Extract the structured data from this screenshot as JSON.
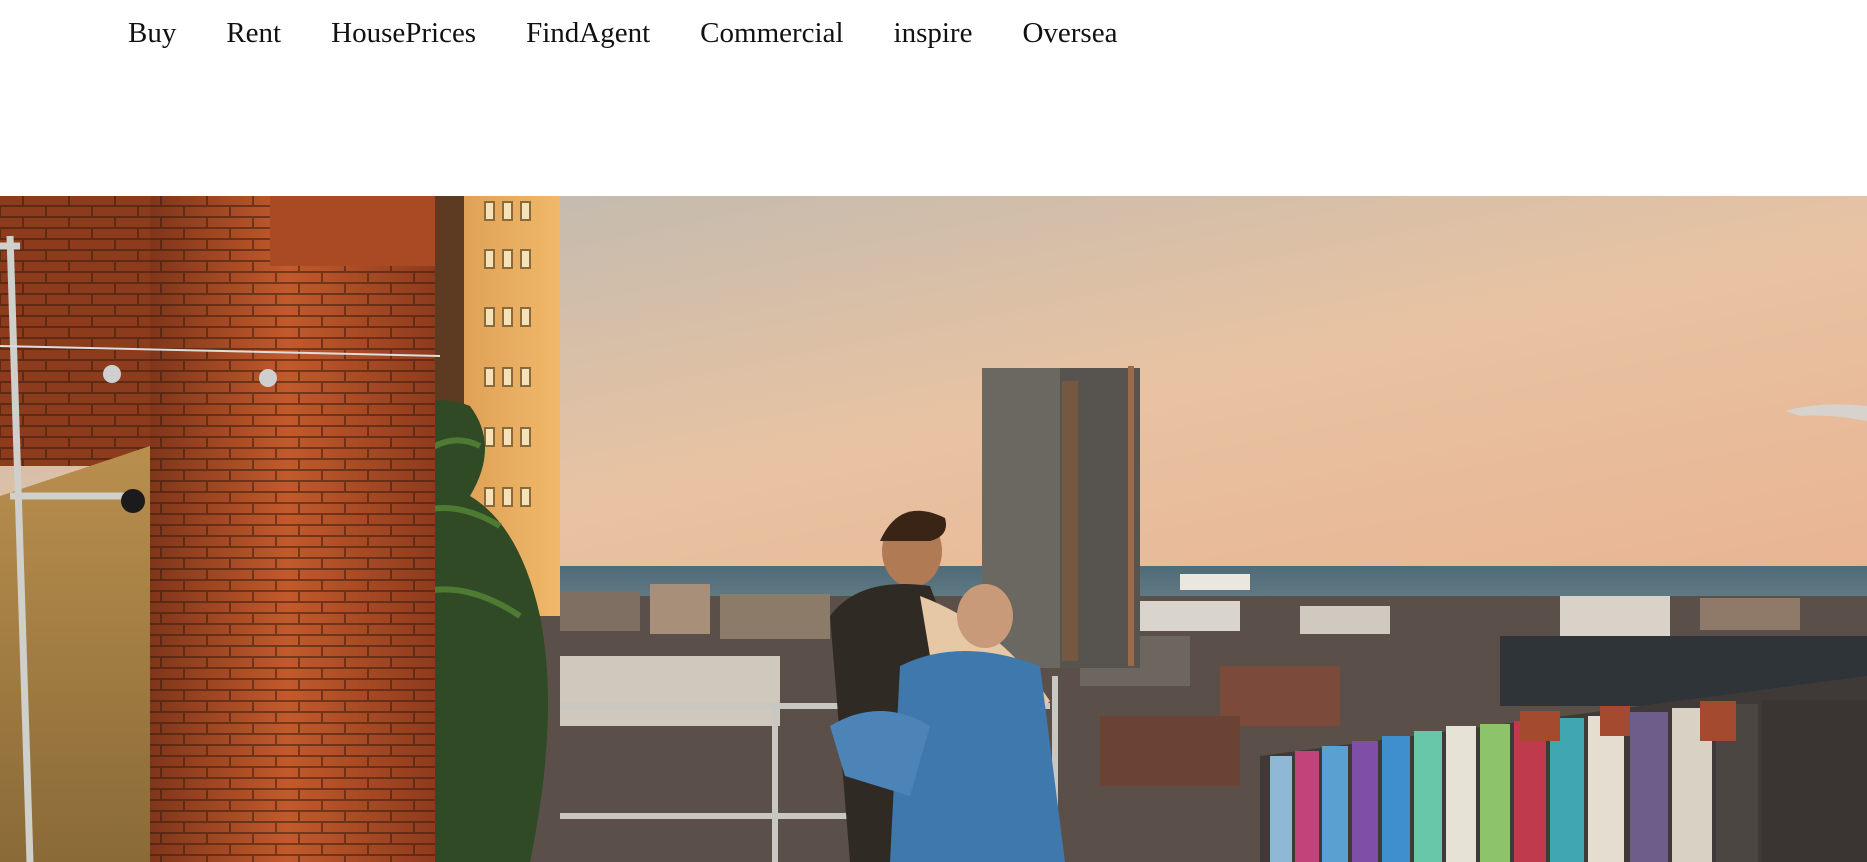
{
  "nav": {
    "items": [
      {
        "label": "Buy"
      },
      {
        "label": "Rent"
      },
      {
        "label": "HousePrices"
      },
      {
        "label": "FindAgent"
      },
      {
        "label": "Commercial"
      },
      {
        "label": "inspire"
      },
      {
        "label": "Oversea"
      }
    ]
  },
  "hero": {
    "colors": {
      "sky_top": "#b9b7b0",
      "sky_bottom": "#f0c6a2",
      "sea": "#5f7a84",
      "brick": "#b6502a",
      "tower": "#6b6761",
      "apartment": "#e0a45a"
    }
  }
}
